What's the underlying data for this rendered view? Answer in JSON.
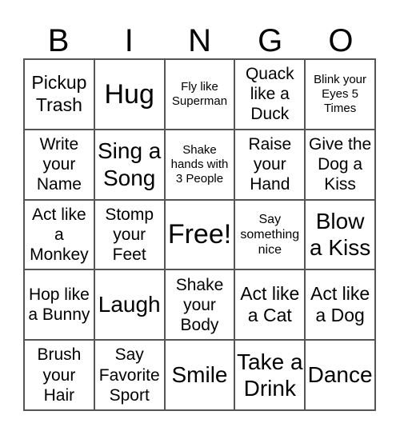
{
  "header": {
    "letters": [
      "B",
      "I",
      "N",
      "G",
      "O"
    ]
  },
  "cells": [
    "Pickup Trash",
    "Hug",
    "Fly like Superman",
    "Quack like a Duck",
    "Blink your Eyes 5 Times",
    "Write your Name",
    "Sing a Song",
    "Shake hands with 3 People",
    "Raise your Hand",
    "Give the Dog a Kiss",
    "Act like a Monkey",
    "Stomp your Feet",
    "Free!",
    "Say something nice",
    "Blow a Kiss",
    "Hop like a Bunny",
    "Laugh",
    "Shake your Body",
    "Act like a Cat",
    "Act like a Dog",
    "Brush your Hair",
    "Say Favorite Sport",
    "Smile",
    "Take a Drink",
    "Dance"
  ]
}
